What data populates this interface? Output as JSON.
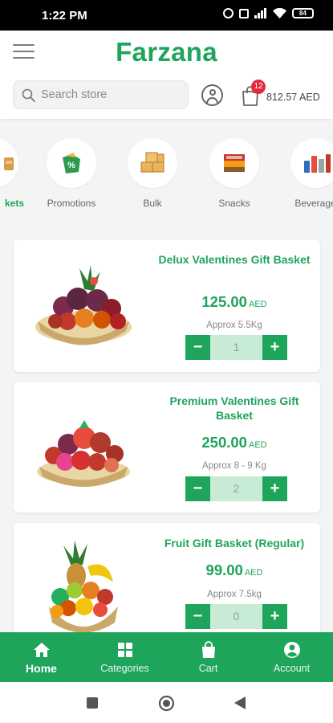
{
  "status_bar": {
    "time": "1:22 PM",
    "battery": "84"
  },
  "header": {
    "logo": "Farzana",
    "search_placeholder": "Search store",
    "cart_count": "12",
    "cart_total": "812.57 AED"
  },
  "categories": [
    {
      "label": "kets",
      "icon": "basket-icon",
      "active": true
    },
    {
      "label": "Promotions",
      "icon": "promotions-icon"
    },
    {
      "label": "Bulk",
      "icon": "bulk-boxes-icon"
    },
    {
      "label": "Snacks",
      "icon": "snacks-icon"
    },
    {
      "label": "Beverage",
      "icon": "beverages-icon"
    }
  ],
  "products": [
    {
      "name": "Delux Valentines Gift Basket",
      "price": "125.00",
      "currency": "AED",
      "weight": "Approx 5.5Kg",
      "qty": "1"
    },
    {
      "name": "Premium Valentines Gift Basket",
      "price": "250.00",
      "currency": "AED",
      "weight": "Approx 8 - 9 Kg",
      "qty": "2"
    },
    {
      "name": "Fruit Gift Basket (Regular)",
      "price": "99.00",
      "currency": "AED",
      "weight": "Approx 7.5kg",
      "qty": "0"
    }
  ],
  "stepper": {
    "minus": "−",
    "plus": "+"
  },
  "bottom_nav": [
    {
      "label": "Home",
      "icon": "home-icon",
      "active": true
    },
    {
      "label": "Categories",
      "icon": "grid-icon"
    },
    {
      "label": "Cart",
      "icon": "bag-icon"
    },
    {
      "label": "Account",
      "icon": "account-icon"
    }
  ],
  "colors": {
    "brand": "#1fa45c",
    "badge": "#e3283b",
    "qty_bg": "#c8ebd6"
  }
}
